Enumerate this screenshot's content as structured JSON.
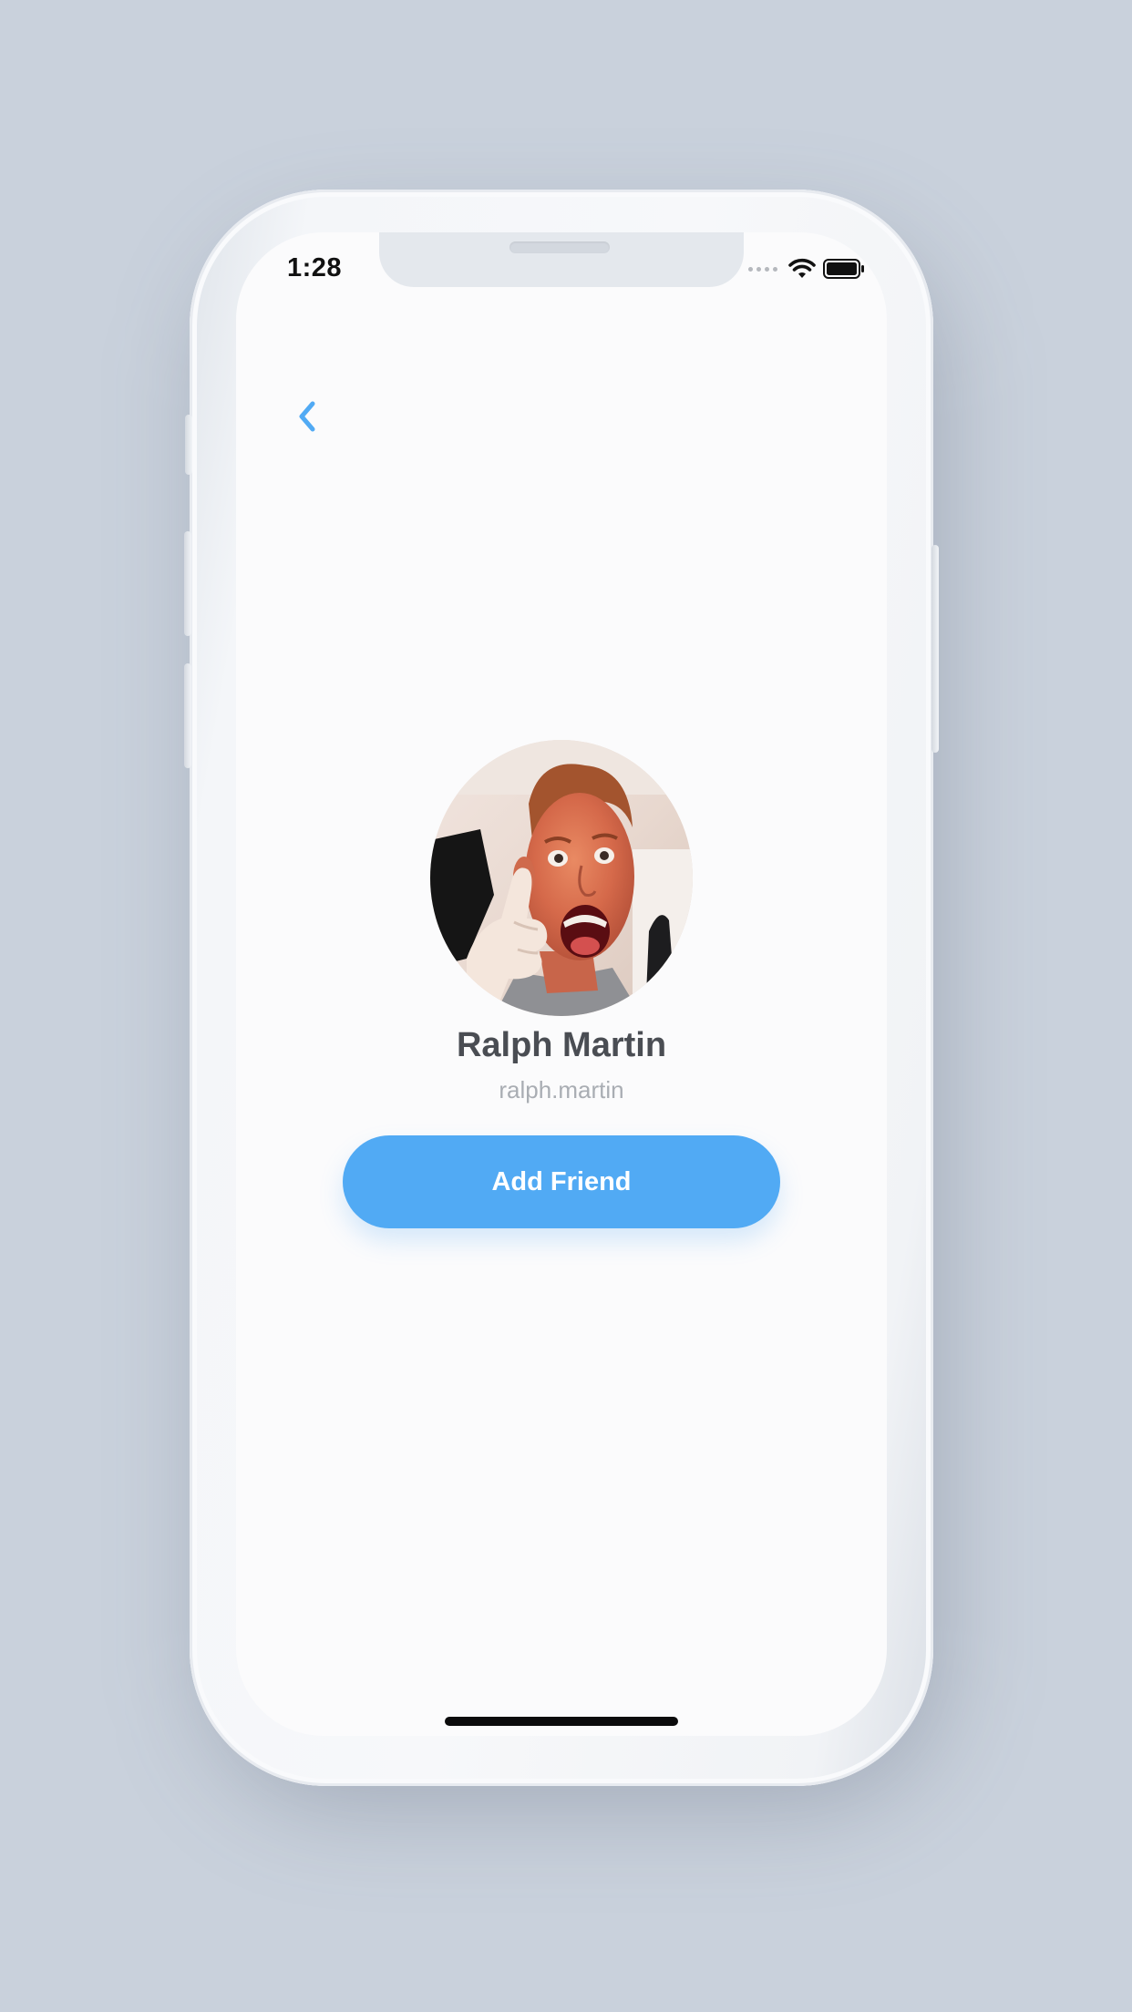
{
  "status_bar": {
    "time": "1:28",
    "icons": [
      "signal-dots-icon",
      "wifi-icon",
      "battery-icon"
    ]
  },
  "navigation": {
    "back_icon": "chevron-left-icon"
  },
  "profile": {
    "avatar": "profile-photo",
    "name": "Ralph Martin",
    "username": "ralph.martin"
  },
  "actions": {
    "add_friend_label": "Add Friend"
  },
  "colors": {
    "accent": "#51aaf4",
    "name_text": "#4a4d53",
    "username_text": "#a9adb3",
    "background": "#c9d1dc",
    "screen": "#fbfbfc"
  }
}
